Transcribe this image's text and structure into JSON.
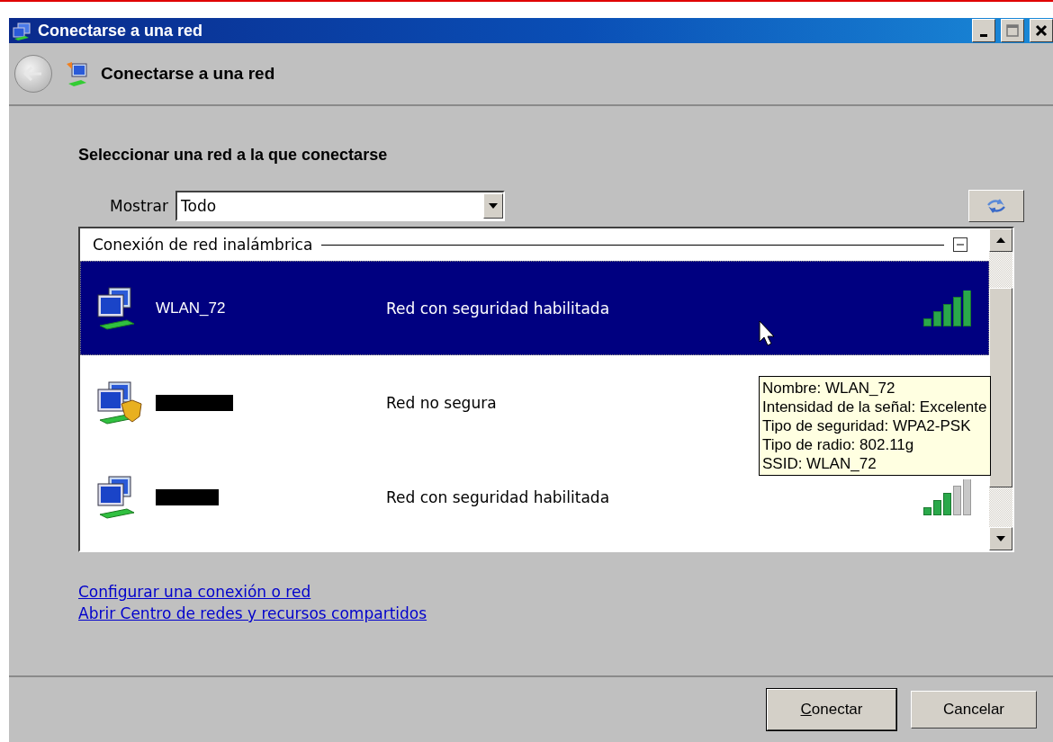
{
  "window": {
    "title": "Conectarse a una red"
  },
  "header": {
    "title": "Conectarse a una red"
  },
  "heading": "Seleccionar una red a la que conectarse",
  "show_filter": {
    "label": "Mostrar",
    "value": "Todo"
  },
  "group": {
    "title": "Conexión de red inalámbrica",
    "expanded": true
  },
  "networks": [
    {
      "name": "WLAN_72",
      "redacted": false,
      "status": "Red con seguridad habilitada",
      "secured": true,
      "strong_signal": true,
      "selected": true
    },
    {
      "redacted": true,
      "status": "Red no segura",
      "secured": false,
      "selected": false
    },
    {
      "redacted": true,
      "status": "Red con seguridad habilitada",
      "secured": true,
      "strong_signal": false,
      "selected": false
    }
  ],
  "tooltip": [
    "Nombre: WLAN_72",
    "Intensidad de la señal: Excelente",
    "Tipo de seguridad: WPA2-PSK",
    "Tipo de radio: 802.11g",
    "SSID: WLAN_72"
  ],
  "links": [
    "Configurar una conexión o red",
    "Abrir Centro de redes y recursos compartidos"
  ],
  "buttons": [
    {
      "label": "Conectar",
      "access_key_underlined": true,
      "default": true
    },
    {
      "label": "Cancelar",
      "default": false
    }
  ]
}
